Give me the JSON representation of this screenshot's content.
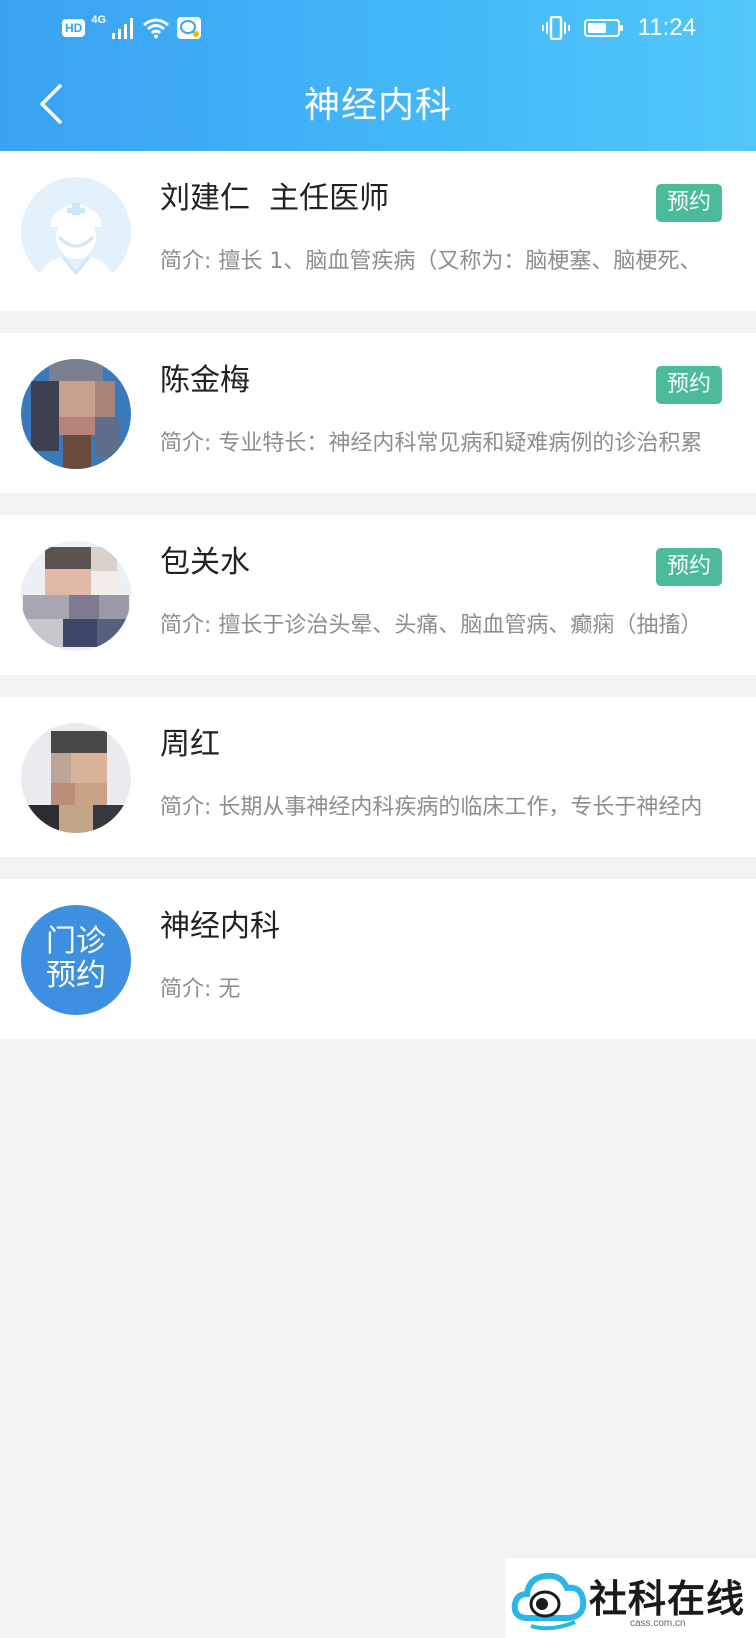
{
  "status_bar": {
    "hd": "HD",
    "network": "4G",
    "time": "11:24"
  },
  "nav": {
    "title": "神经内科"
  },
  "doctors": [
    {
      "name": "刘建仁  主任医师",
      "intro": "简介: 擅长 1、脑血管疾病（又称为：脑梗塞、脑梗死、",
      "book_label": "预约"
    },
    {
      "name": "陈金梅",
      "intro": "简介: 专业特长：神经内科常见病和疑难病例的诊治积累",
      "book_label": "预约"
    },
    {
      "name": "包关水",
      "intro": "简介: 擅长于诊治头晕、头痛、脑血管病、癫痫（抽搐）",
      "book_label": "预约"
    },
    {
      "name": "周红",
      "intro": "简介: 长期从事神经内科疾病的临床工作，专长于神经内"
    },
    {
      "name": "神经内科",
      "intro": "简介: 无",
      "avatar_text_line1": "门诊",
      "avatar_text_line2": "预约"
    }
  ],
  "watermark": {
    "text": "社科在线",
    "sub": "cass.com.cn"
  },
  "colors": {
    "header_start": "#3aa2f3",
    "header_end": "#52c7fb",
    "book_button": "#4cbb9a",
    "clinic_avatar": "#3d8fe0"
  }
}
